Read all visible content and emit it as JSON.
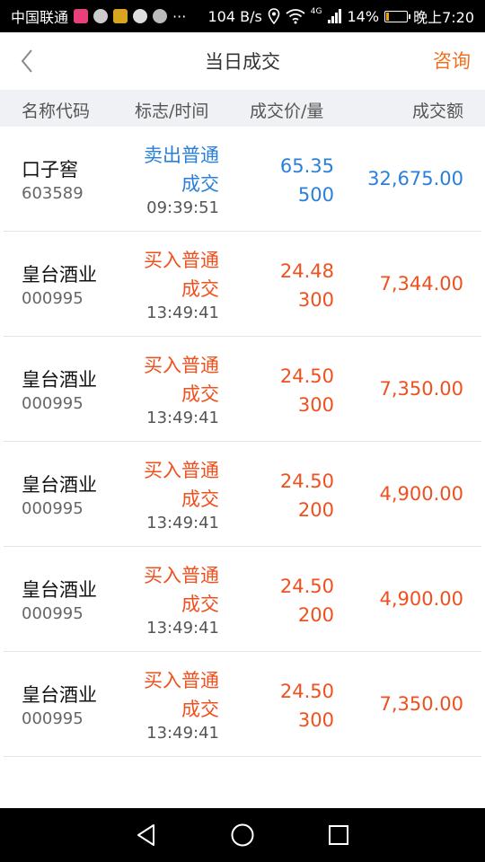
{
  "status_bar": {
    "carrier": "中国联通",
    "dots": "···",
    "speed": "104 B/s",
    "network": "4G",
    "battery_pct": "14%",
    "battery_level": 0.14,
    "time": "晚上7:20"
  },
  "nav": {
    "title": "当日成交",
    "action": "咨询"
  },
  "table": {
    "headers": {
      "name": "名称代码",
      "flag": "标志/时间",
      "price": "成交价/量",
      "amount": "成交额"
    },
    "rows": [
      {
        "name": "口子窖",
        "code": "603589",
        "flag1": "卖出普通",
        "flag2": "成交",
        "time": "09:39:51",
        "price": "65.35",
        "qty": "500",
        "amount": "32,675.00",
        "side": "sell"
      },
      {
        "name": "皇台酒业",
        "code": "000995",
        "flag1": "买入普通",
        "flag2": "成交",
        "time": "13:49:41",
        "price": "24.48",
        "qty": "300",
        "amount": "7,344.00",
        "side": "buy"
      },
      {
        "name": "皇台酒业",
        "code": "000995",
        "flag1": "买入普通",
        "flag2": "成交",
        "time": "13:49:41",
        "price": "24.50",
        "qty": "300",
        "amount": "7,350.00",
        "side": "buy"
      },
      {
        "name": "皇台酒业",
        "code": "000995",
        "flag1": "买入普通",
        "flag2": "成交",
        "time": "13:49:41",
        "price": "24.50",
        "qty": "200",
        "amount": "4,900.00",
        "side": "buy"
      },
      {
        "name": "皇台酒业",
        "code": "000995",
        "flag1": "买入普通",
        "flag2": "成交",
        "time": "13:49:41",
        "price": "24.50",
        "qty": "200",
        "amount": "4,900.00",
        "side": "buy"
      },
      {
        "name": "皇台酒业",
        "code": "000995",
        "flag1": "买入普通",
        "flag2": "成交",
        "time": "13:49:41",
        "price": "24.50",
        "qty": "300",
        "amount": "7,350.00",
        "side": "buy"
      }
    ]
  },
  "colors": {
    "sell": "#2a80d8",
    "buy": "#f0501e",
    "accent": "#f07020"
  },
  "icons": {
    "back": "chevron-left-icon",
    "sys_back": "triangle-back-icon",
    "sys_home": "circle-home-icon",
    "sys_recent": "square-recent-icon"
  }
}
